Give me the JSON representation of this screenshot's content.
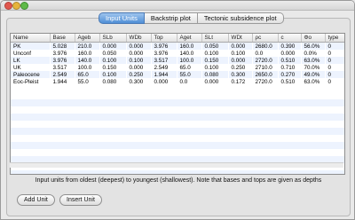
{
  "tabs": [
    "Input Units",
    "Backstrip plot",
    "Tectonic subsidence plot"
  ],
  "table": {
    "columns": [
      "Name",
      "Base",
      "Ageb",
      "SLb",
      "WDb",
      "Top",
      "Aget",
      "SLt",
      "WDt",
      "ρc",
      "c",
      "Φo",
      "type"
    ],
    "rows": [
      [
        "PK",
        "5.028",
        "210.0",
        "0.000",
        "0.000",
        "3.976",
        "160.0",
        "0.050",
        "0.000",
        "2680.0",
        "0.390",
        "56.0%",
        "0"
      ],
      [
        "Unconf",
        "3.976",
        "160.0",
        "0.050",
        "0.000",
        "3.976",
        "140.0",
        "0.100",
        "0.100",
        "0.0",
        "0.000",
        "0.0%",
        "0"
      ],
      [
        "LK",
        "3.976",
        "140.0",
        "0.100",
        "0.100",
        "3.517",
        "100.0",
        "0.150",
        "0.000",
        "2720.0",
        "0.510",
        "63.0%",
        "0"
      ],
      [
        "UK",
        "3.517",
        "100.0",
        "0.150",
        "0.000",
        "2.549",
        "65.0",
        "0.100",
        "0.250",
        "2710.0",
        "0.710",
        "70.0%",
        "0"
      ],
      [
        "Paleocene",
        "2.549",
        "65.0",
        "0.100",
        "0.250",
        "1.944",
        "55.0",
        "0.080",
        "0.300",
        "2650.0",
        "0.270",
        "49.0%",
        "0"
      ],
      [
        "Eoc-Pleist",
        "1.944",
        "55.0",
        "0.080",
        "0.300",
        "0.000",
        "0.0",
        "0.000",
        "0.172",
        "2720.0",
        "0.510",
        "63.0%",
        "0"
      ]
    ]
  },
  "note": "Input units from oldest (deepest) to youngest (shallowest). Note that bases and tops are given as depths",
  "buttons": {
    "add": "Add Unit",
    "insert": "Insert Unit"
  },
  "colors": {
    "active_tab": "#4f8fd6",
    "row_stripe": "#edf3fe"
  }
}
